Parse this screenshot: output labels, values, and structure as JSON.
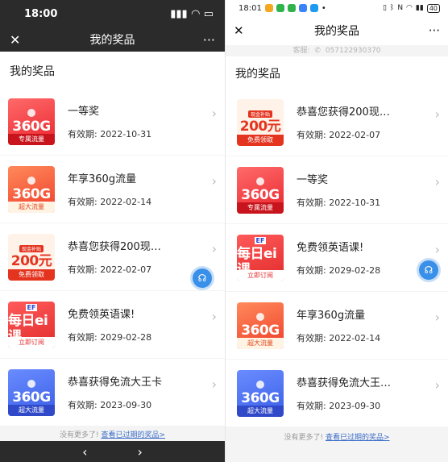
{
  "left": {
    "status": {
      "time": "18:00"
    },
    "nav": {
      "title": "我的奖品",
      "close_icon": "close-icon",
      "more_icon": "more-icon"
    },
    "section_title": "我的奖品",
    "items": [
      {
        "thumb": {
          "style": "red",
          "big": "360G",
          "ribbon": "专属流量"
        },
        "name": "一等奖",
        "validity": "有效期: 2022-10-31"
      },
      {
        "thumb": {
          "style": "orange",
          "big": "360G",
          "ribbon": "超大流量"
        },
        "name": "年享360g流量",
        "validity": "有效期: 2022-02-14"
      },
      {
        "thumb": {
          "style": "w200",
          "badge": "现金补贴",
          "big": "200元",
          "ribbon": "免费领取"
        },
        "name": "恭喜您获得200现…",
        "validity": "有效期: 2022-02-07"
      },
      {
        "thumb": {
          "style": "ei",
          "ef": "EF",
          "big": "每日ei课",
          "ribbon": "立即订阅"
        },
        "name": "免费领英语课!",
        "validity": "有效期: 2029-02-28"
      },
      {
        "thumb": {
          "style": "blue",
          "big": "360G",
          "ribbon": "超大流量"
        },
        "name": "恭喜获得免流大王卡",
        "validity": "有效期: 2023-09-30"
      }
    ],
    "footer": {
      "text": "没有更多了!",
      "link": "查看已过期的奖品>"
    },
    "bottom_nav": {
      "back": "‹",
      "forward": "›"
    }
  },
  "right": {
    "status": {
      "time": "18:01",
      "battery": "40"
    },
    "nav": {
      "title": "我的奖品"
    },
    "service": {
      "label": "客服:",
      "phone": "057122930370"
    },
    "section_title": "我的奖品",
    "items": [
      {
        "thumb": {
          "style": "w200",
          "badge": "现金补贴",
          "big": "200元",
          "ribbon": "免费领取"
        },
        "name": "恭喜您获得200现…",
        "validity": "有效期: 2022-02-07"
      },
      {
        "thumb": {
          "style": "red",
          "big": "360G",
          "ribbon": "专属流量"
        },
        "name": "一等奖",
        "validity": "有效期: 2022-10-31"
      },
      {
        "thumb": {
          "style": "ei",
          "ef": "EF",
          "big": "每日ei课",
          "ribbon": "立即订阅"
        },
        "name": "免费领英语课!",
        "validity": "有效期: 2029-02-28"
      },
      {
        "thumb": {
          "style": "orange",
          "big": "360G",
          "ribbon": "超大流量"
        },
        "name": "年享360g流量",
        "validity": "有效期: 2022-02-14"
      },
      {
        "thumb": {
          "style": "blue",
          "big": "360G",
          "ribbon": "超大流量"
        },
        "name": "恭喜获得免流大王…",
        "validity": "有效期: 2023-09-30"
      }
    ],
    "footer": {
      "text": "没有更多了!",
      "link": "查看已过期的奖品>"
    }
  },
  "colors": {
    "link": "#3a6cc8",
    "fab": "#3a90e8",
    "accent_red": "#e9262e"
  }
}
